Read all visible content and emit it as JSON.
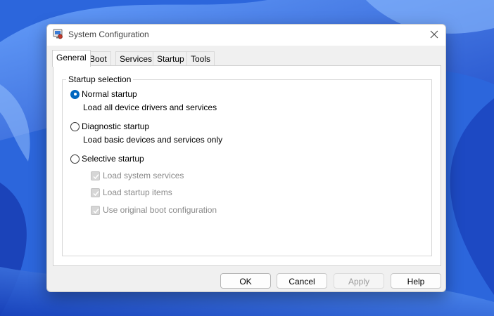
{
  "window": {
    "title": "System Configuration",
    "app_icon": "msconfig-icon",
    "close_icon": "close-icon"
  },
  "tabs": [
    {
      "label": "General",
      "active": true
    },
    {
      "label": "Boot",
      "active": false
    },
    {
      "label": "Services",
      "active": false
    },
    {
      "label": "Startup",
      "active": false
    },
    {
      "label": "Tools",
      "active": false
    }
  ],
  "startup_selection": {
    "group_label": "Startup selection",
    "options": [
      {
        "label": "Normal startup",
        "description": "Load all device drivers and services",
        "selected": true
      },
      {
        "label": "Diagnostic startup",
        "description": "Load basic devices and services only",
        "selected": false
      },
      {
        "label": "Selective startup",
        "selected": false
      }
    ],
    "selective_items": [
      {
        "label": "Load system services",
        "checked": true,
        "enabled": false
      },
      {
        "label": "Load startup items",
        "checked": true,
        "enabled": false
      },
      {
        "label": "Use original boot configuration",
        "checked": true,
        "enabled": false
      }
    ]
  },
  "buttons": {
    "ok": "OK",
    "cancel": "Cancel",
    "apply": "Apply",
    "help": "Help"
  },
  "colors": {
    "accent": "#0067c0",
    "wallpaper": "#2f6fe0"
  }
}
